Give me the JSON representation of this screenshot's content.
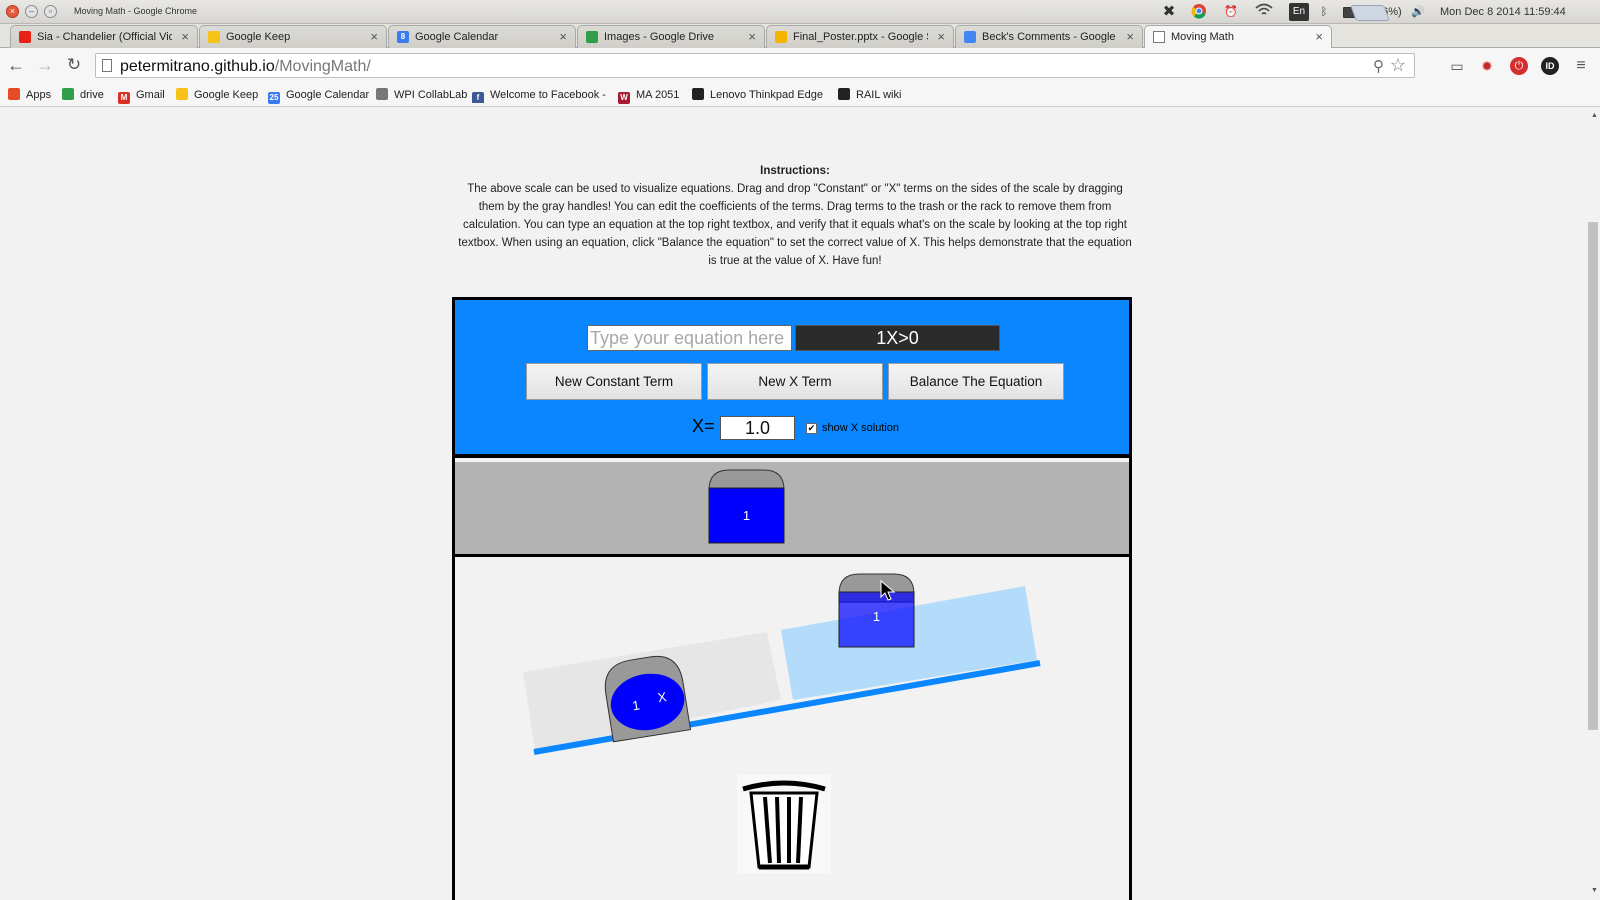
{
  "os": {
    "window_title": "Moving Math - Google Chrome",
    "battery": "(96%)",
    "clock": "Mon Dec 8 2014 11:59:44",
    "language": "En"
  },
  "tabs": [
    {
      "label": "Sia - Chandelier (Official Video)",
      "icon": "youtube-icon",
      "color": "#e62117"
    },
    {
      "label": "Google Keep",
      "icon": "keep-icon",
      "color": "#f7c318"
    },
    {
      "label": "Google Calendar",
      "icon": "calendar-icon",
      "color": "#3a7cf0",
      "glyph": "8"
    },
    {
      "label": "Images - Google Drive",
      "icon": "drive-icon",
      "color": "#2e9e4a"
    },
    {
      "label": "Final_Poster.pptx - Google Slides",
      "icon": "slides-icon",
      "color": "#f4b400"
    },
    {
      "label": "Beck's Comments - Google Docs",
      "icon": "docs-icon",
      "color": "#4285f4"
    },
    {
      "label": "Moving Math",
      "icon": "page-icon",
      "color": "#ffffff"
    }
  ],
  "omnibox": {
    "host": "petermitrano.github.io",
    "path": "/MovingMath/"
  },
  "bookmarks": [
    {
      "label": "Apps",
      "icon": "apps-grid-icon",
      "color": "#e34c26"
    },
    {
      "label": "drive",
      "icon": "drive-icon",
      "color": "#2e9e4a"
    },
    {
      "label": "Gmail",
      "icon": "gmail-icon",
      "color": "#d93025",
      "glyph": "M"
    },
    {
      "label": "Google Keep",
      "icon": "keep-icon",
      "color": "#f7c318"
    },
    {
      "label": "Google Calendar",
      "icon": "calendar-icon",
      "color": "#3a7cf0",
      "glyph": "25"
    },
    {
      "label": "WPI CollabLab",
      "icon": "collablab-icon",
      "color": "#777777"
    },
    {
      "label": "Welcome to Facebook - Log In",
      "icon": "facebook-icon",
      "color": "#3b5998",
      "glyph": "f"
    },
    {
      "label": "MA 2051",
      "icon": "wpi-icon",
      "color": "#a6192e",
      "glyph": "W"
    },
    {
      "label": "Lenovo Thinkpad Edge & Ideapad",
      "icon": "lenovo-icon",
      "color": "#222222"
    },
    {
      "label": "RAIL wiki",
      "icon": "github-icon",
      "color": "#222222"
    }
  ],
  "instructions": {
    "heading": "Instructions:",
    "body": "The above scale can be used to visualize equations. Drag and drop \"Constant\" or \"X\" terms on the sides of the scale by dragging them by the gray handles! You can edit the coefficients of the terms. Drag terms to the trash or the rack to remove them from calculation. You can type an equation at the top right textbox, and verify that it equals what's on the scale by looking at the top right textbox. When using an equation, click \"Balance the equation\" to set the correct value of X. This helps demonstrate that the equation is true at the value of X. Have fun!"
  },
  "controls": {
    "equation_placeholder": "Type your equation here",
    "equation_display": "1X>0",
    "new_constant_label": "New Constant Term",
    "new_x_label": "New X Term",
    "balance_label": "Balance The Equation",
    "x_label": "X=",
    "x_value": "1.0",
    "show_solution_checked": true,
    "show_solution_label": "show X solution"
  },
  "rack": {
    "term": {
      "type": "constant",
      "coefficient": "1",
      "color": "#0000ff"
    }
  },
  "scale": {
    "left_terms": [
      {
        "type": "x",
        "coefficient": "1",
        "variable": "X",
        "color": "#0000ff"
      }
    ],
    "right_terms": [
      {
        "type": "constant",
        "coefficient": "1",
        "color": "#0000ff"
      }
    ],
    "left_pan_color": "#e6e6e6",
    "right_pan_color": "#b3dcfa",
    "beam_color": "#0a87ff"
  },
  "colors": {
    "panel_blue": "#0a87ff",
    "rack_gray": "#b3b3b3"
  }
}
